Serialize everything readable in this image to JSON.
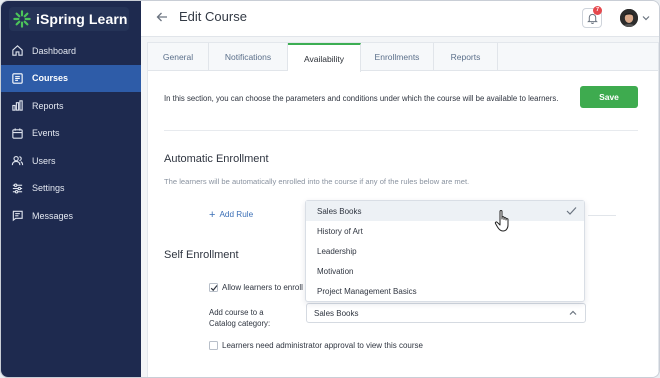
{
  "app": {
    "name": "iSpring Learn"
  },
  "sidebar": {
    "items": [
      {
        "label": "Dashboard",
        "icon": "home-icon",
        "active": false
      },
      {
        "label": "Courses",
        "icon": "courses-icon",
        "active": true
      },
      {
        "label": "Reports",
        "icon": "bar-chart-icon",
        "active": false
      },
      {
        "label": "Events",
        "icon": "calendar-icon",
        "active": false
      },
      {
        "label": "Users",
        "icon": "users-icon",
        "active": false
      },
      {
        "label": "Settings",
        "icon": "sliders-icon",
        "active": false
      },
      {
        "label": "Messages",
        "icon": "message-icon",
        "active": false
      }
    ]
  },
  "header": {
    "title": "Edit Course",
    "notifications_count": "7"
  },
  "tabs": [
    {
      "label": "General",
      "active": false
    },
    {
      "label": "Notifications",
      "active": false
    },
    {
      "label": "Availability",
      "active": true
    },
    {
      "label": "Enrollments",
      "active": false
    },
    {
      "label": "Reports",
      "active": false
    }
  ],
  "main": {
    "intro": "In this section, you can choose the parameters and conditions under which the course will be available to learners.",
    "save_label": "Save",
    "auto_enrollment": {
      "title": "Automatic Enrollment",
      "description": "The learners will be automatically enrolled into the course if any of the rules below are met.",
      "add_rule_label": "Add Rule"
    },
    "self_enrollment": {
      "title": "Self Enrollment",
      "allow_label": "Allow learners to enroll",
      "allow_checked": true,
      "catalog_label_line1": "Add course to a",
      "catalog_label_line2": "Catalog category:",
      "catalog_value": "Sales Books",
      "approval_label": "Learners need administrator approval to view this course",
      "approval_checked": false
    }
  },
  "dropdown": {
    "options": [
      "Sales Books",
      "History of Art",
      "Leadership",
      "Motivation",
      "Project Management Basics"
    ],
    "selected": "Sales Books"
  },
  "colors": {
    "sidebar_bg": "#1e2a4f",
    "sidebar_active": "#2e5ca8",
    "accent_green": "#3eab4f",
    "link_blue": "#3b6fb6",
    "badge_red": "#e5484d"
  }
}
